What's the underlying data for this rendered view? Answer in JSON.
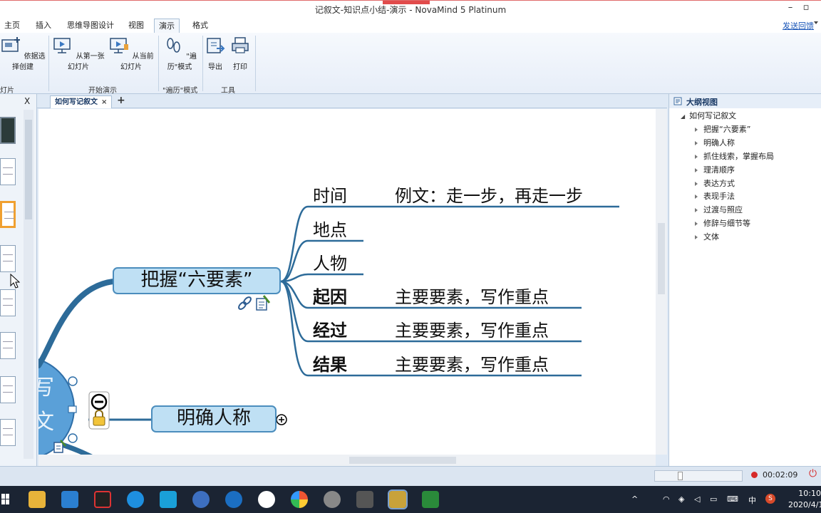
{
  "window": {
    "title": "记叙文-知识点小结-演示 - NovaMind 5 Platinum"
  },
  "ribbon_tabs": [
    "主页",
    "插入",
    "思维导图设计",
    "视图",
    "演示",
    "格式"
  ],
  "active_tab": "演示",
  "help_link": "发送回馈",
  "ribbon": {
    "buttons": {
      "create_from_selection": "依据选择创建",
      "from_first_slide": "从第一张幻灯片",
      "from_current_slide": "从当前幻灯片",
      "traverse_mode": "\"遍历\"模式",
      "export": "导出",
      "print": "打印"
    },
    "groups": {
      "slides": "灯片",
      "start_show": "开始演示",
      "traverse": "\"遍历\"模式",
      "tools": "工具"
    }
  },
  "slides_pane": {
    "close": "X"
  },
  "document_tab": {
    "label": "如何写记叙文",
    "close": "×",
    "add": "+"
  },
  "mindmap": {
    "central_fragment_1": "写",
    "central_fragment_2": "文",
    "topic_main": "把握“六要素”",
    "topic_person": "明确人称",
    "branches": [
      {
        "label": "时间",
        "note": "例文：走一步，再走一步"
      },
      {
        "label": "地点",
        "note": ""
      },
      {
        "label": "人物",
        "note": ""
      },
      {
        "label": "起因",
        "note": "主要要素，写作重点"
      },
      {
        "label": "经过",
        "note": "主要要素，写作重点"
      },
      {
        "label": "结果",
        "note": "主要要素，写作重点"
      }
    ]
  },
  "outline": {
    "title": "大纲视图",
    "root": "如何写记叙文",
    "items": [
      "把握“六要素”",
      "明确人称",
      "抓住线索，掌握布局",
      "理清顺序",
      "表达方式",
      "表现手法",
      "过渡与照应",
      "修辞与细节等",
      "文体"
    ]
  },
  "status": {
    "timer": "00:02:09"
  },
  "taskbar": {
    "tray_lang": "中",
    "tray_ime": "S",
    "clock_time": "10:10",
    "clock_date": "2020/4/1"
  }
}
